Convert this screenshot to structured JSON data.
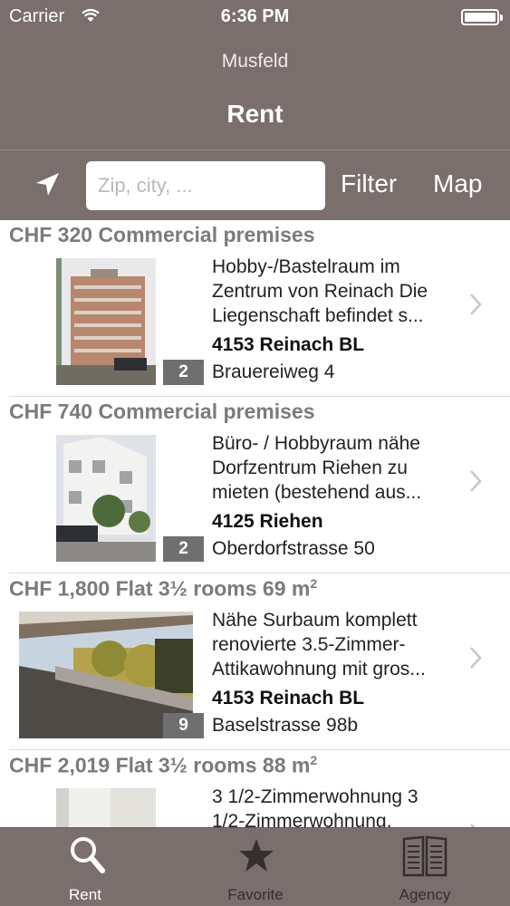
{
  "status_bar": {
    "carrier": "Carrier",
    "time": "6:36 PM"
  },
  "header": {
    "location": "Musfeld",
    "title": "Rent"
  },
  "search": {
    "placeholder": "Zip, city, ...",
    "value": ""
  },
  "toolbar": {
    "filter_label": "Filter",
    "map_label": "Map"
  },
  "listings": [
    {
      "price": "CHF 320",
      "type": "Commercial premises",
      "description_line1": "Hobby-/Bastelraum im",
      "description_line2": "Zentrum von Reinach Die",
      "description_line3": "Liegenschaft befindet s...",
      "locality": "4153 Reinach BL",
      "street": "Brauereiweg 4",
      "photo_count": "2"
    },
    {
      "price": "CHF 740",
      "type": "Commercial premises",
      "description_line1": "Büro- / Hobbyraum nähe",
      "description_line2": "Dorfzentrum Riehen zu",
      "description_line3": "mieten (bestehend aus...",
      "locality": "4125 Riehen",
      "street": "Oberdorfstrasse 50",
      "photo_count": "2"
    },
    {
      "price": "CHF 1,800",
      "type": "Flat 3½  rooms 69 m",
      "area_unit_exponent": "2",
      "description_line1": "Nähe Surbaum komplett",
      "description_line2": "renovierte 3.5-Zimmer-",
      "description_line3": "Attikawohnung mit gros...",
      "locality": "4153 Reinach BL",
      "street": "Baselstrasse 98b",
      "photo_count": "9"
    },
    {
      "price": "CHF 2,019",
      "type": "Flat 3½  rooms 88 m",
      "area_unit_exponent": "2",
      "description_line1": "3 1/2-Zimmerwohnung 3",
      "description_line2": "1/2-Zimmerwohnung,"
    }
  ],
  "tabbar": {
    "tabs": [
      {
        "label": "Rent",
        "icon": "search-icon",
        "active": true
      },
      {
        "label": "Favorite",
        "icon": "star-icon",
        "active": false
      },
      {
        "label": "Agency",
        "icon": "book-icon",
        "active": false
      }
    ]
  },
  "colors": {
    "header_bg": "#7a6f6c",
    "tab_inactive": "#352f2d",
    "price_text": "#7b7b7b",
    "photo_badge": "#6f6f6f"
  }
}
